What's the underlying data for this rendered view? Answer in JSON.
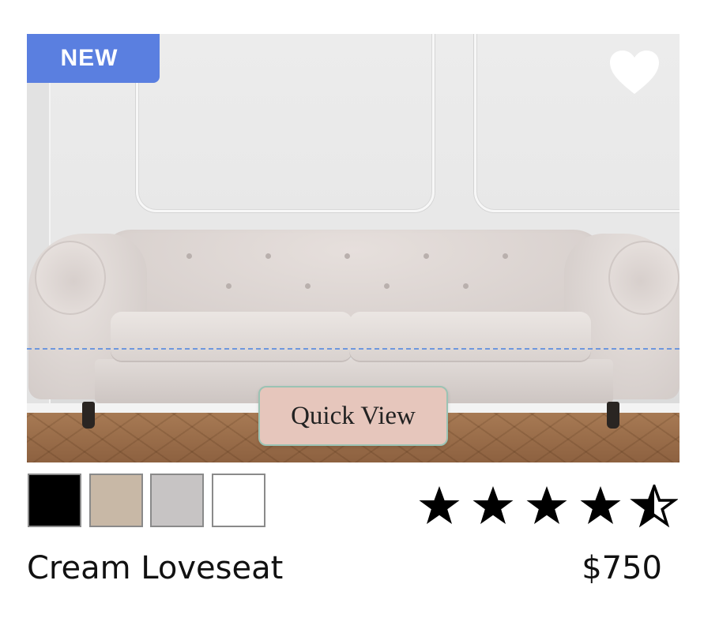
{
  "badge": {
    "label": "NEW",
    "color": "#5a7fe0"
  },
  "favorite": {
    "icon": "heart-icon",
    "active": false
  },
  "quick_view": {
    "label": "Quick View"
  },
  "swatches": [
    {
      "name": "black",
      "color": "#000000"
    },
    {
      "name": "beige",
      "color": "#c8b8a6"
    },
    {
      "name": "grey",
      "color": "#c7c4c4"
    },
    {
      "name": "white",
      "color": "#ffffff"
    }
  ],
  "rating": {
    "value": 4.5,
    "max": 5
  },
  "product": {
    "name": "Cream Loveseat",
    "price": "$750"
  }
}
